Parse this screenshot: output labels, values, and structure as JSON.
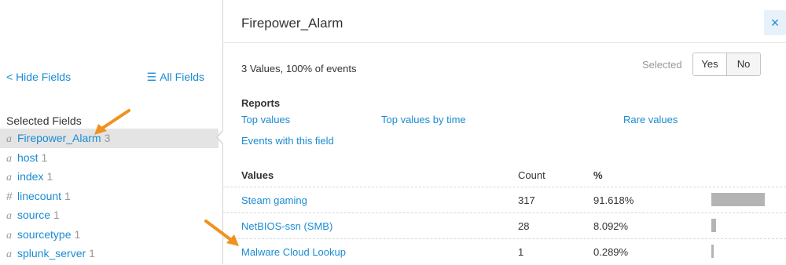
{
  "sidebar": {
    "hide_fields": "< Hide Fields",
    "all_fields_icon": "list-icon",
    "all_fields": "All Fields",
    "selected_fields_title": "Selected Fields",
    "fields": [
      {
        "type": "a",
        "name": "Firepower_Alarm",
        "count": "3",
        "active": true
      },
      {
        "type": "a",
        "name": "host",
        "count": "1"
      },
      {
        "type": "a",
        "name": "index",
        "count": "1"
      },
      {
        "type": "#",
        "name": "linecount",
        "count": "1"
      },
      {
        "type": "a",
        "name": "source",
        "count": "1"
      },
      {
        "type": "a",
        "name": "sourcetype",
        "count": "1"
      },
      {
        "type": "a",
        "name": "splunk_server",
        "count": "1"
      }
    ]
  },
  "popover": {
    "title": "Firepower_Alarm",
    "close": "×",
    "summary": "3 Values, 100% of events",
    "selected_label": "Selected",
    "yes": "Yes",
    "no": "No",
    "reports_title": "Reports",
    "reports": {
      "top_values": "Top values",
      "top_values_by_time": "Top values by time",
      "rare_values": "Rare values",
      "events_with_field": "Events with this field"
    },
    "headers": {
      "values": "Values",
      "count": "Count",
      "percent": "%"
    },
    "rows": [
      {
        "value": "Steam gaming",
        "count": "317",
        "percent": "91.618%",
        "fraction": 0.91618
      },
      {
        "value": "NetBIOS-ssn (SMB)",
        "count": "28",
        "percent": "8.092%",
        "fraction": 0.08092
      },
      {
        "value": "Malware Cloud Lookup",
        "count": "1",
        "percent": "0.289%",
        "fraction": 0.00289
      }
    ]
  },
  "colors": {
    "link": "#1a8bd1",
    "arrow": "#f0921f",
    "bar": "#b4b4b4",
    "active_row": "#e4e4e4"
  }
}
